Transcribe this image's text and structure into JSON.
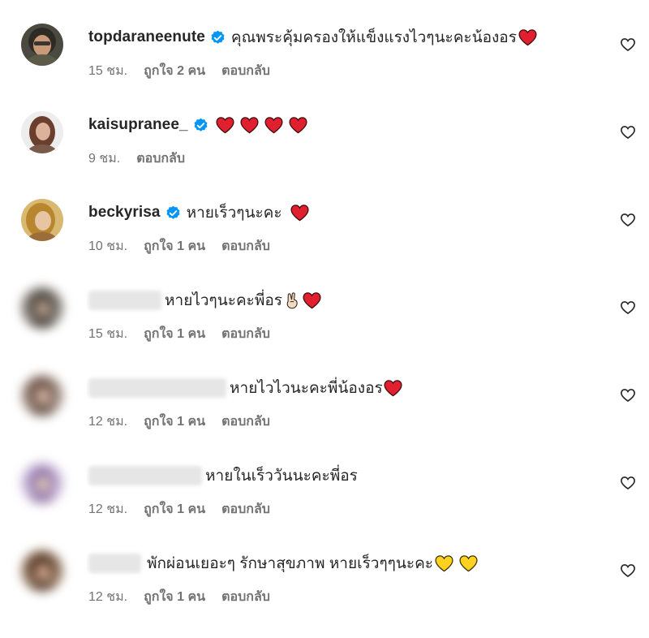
{
  "comments": [
    {
      "username": "topdaraneenute",
      "verified": true,
      "blurred": false,
      "text": "คุณพระคุ้มครองให้แข็งแรงไวๆนะคะน้องอร",
      "emojis": [
        "red-heart"
      ],
      "time": "15 ชม.",
      "likes": "ถูกใจ 2 คน",
      "reply": "ตอบกลับ"
    },
    {
      "username": "kaisupranee_",
      "verified": true,
      "blurred": false,
      "text": "",
      "emojis": [
        "red-heart",
        "red-heart",
        "red-heart",
        "red-heart"
      ],
      "time": "9 ชม.",
      "likes": "",
      "reply": "ตอบกลับ"
    },
    {
      "username": "beckyrisa",
      "verified": true,
      "blurred": false,
      "text": "หายเร็วๆนะคะ",
      "emojis": [
        "red-heart"
      ],
      "time": "10 ชม.",
      "likes": "ถูกใจ 1 คน",
      "reply": "ตอบกลับ"
    },
    {
      "username": "",
      "verified": false,
      "blurred": true,
      "text": "หายไวๆนะคะพี่อร",
      "emojis": [
        "victory-hand",
        "red-heart"
      ],
      "time": "15 ชม.",
      "likes": "ถูกใจ 1 คน",
      "reply": "ตอบกลับ"
    },
    {
      "username": "",
      "verified": false,
      "blurred": true,
      "text": "หายไวไวนะคะพี่น้องอร",
      "emojis": [
        "red-heart"
      ],
      "time": "12 ชม.",
      "likes": "ถูกใจ 1 คน",
      "reply": "ตอบกลับ"
    },
    {
      "username": "",
      "verified": false,
      "blurred": true,
      "text": "หายในเร็ววันนะคะพี่อร",
      "emojis": [],
      "time": "12 ชม.",
      "likes": "ถูกใจ 1 คน",
      "reply": "ตอบกลับ"
    },
    {
      "username": "",
      "verified": false,
      "blurred": true,
      "text": "พักผ่อนเยอะๆ รักษาสุขภาพ หายเร็วๆๆนะคะ",
      "emojis": [
        "yellow-heart",
        "yellow-heart"
      ],
      "time": "12 ชม.",
      "likes": "ถูกใจ 1 คน",
      "reply": "ตอบกลับ"
    }
  ],
  "colors": {
    "text": "#262626",
    "meta": "#737373",
    "verified": "#0095f6",
    "red_heart": "#e0202e",
    "yellow_heart": "#ffd21f"
  }
}
